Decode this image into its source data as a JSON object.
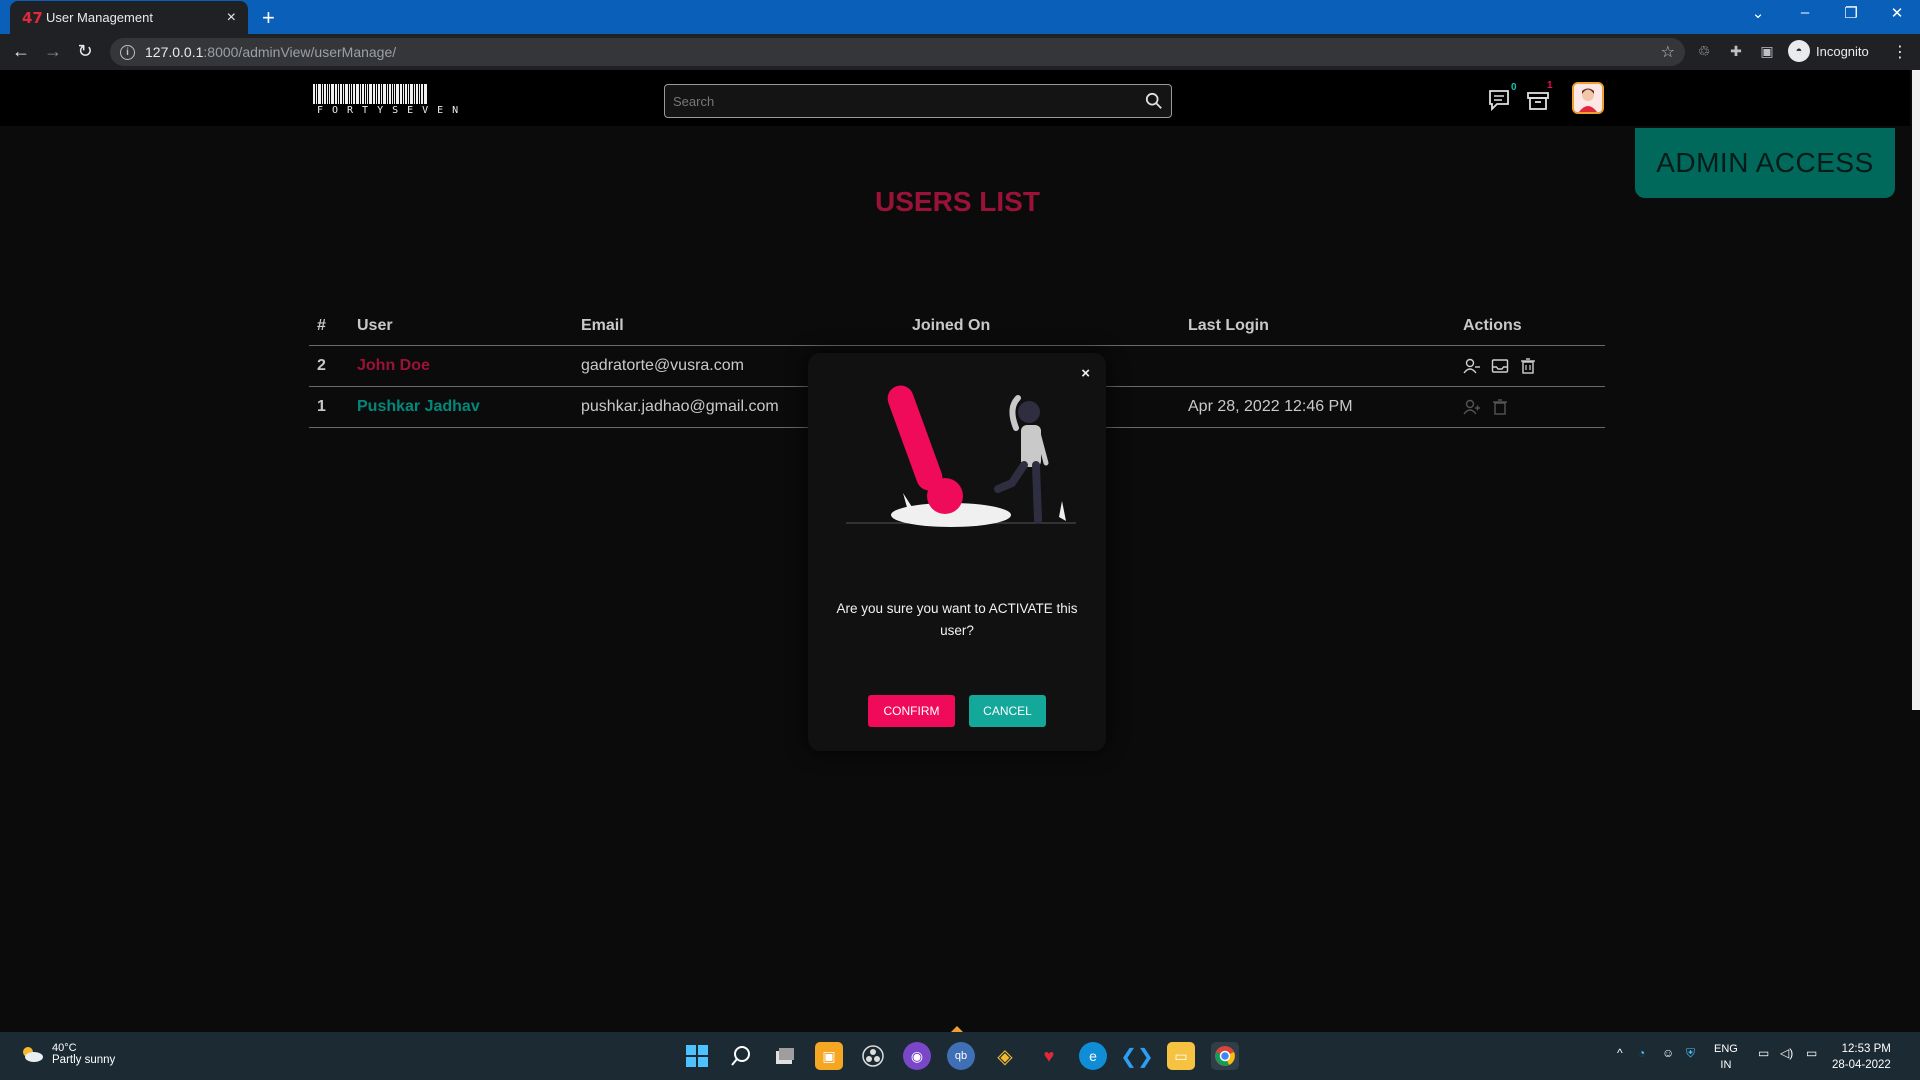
{
  "browser": {
    "tab_icon": "47",
    "tab_title": "User Management",
    "url_host": "127.0.0.1",
    "url_path": ":8000/adminView/userManage/",
    "profile_label": "Incognito"
  },
  "header": {
    "logo_text": "FORTYSEVEN",
    "search_placeholder": "Search",
    "messages_badge": "0",
    "archive_badge": "1",
    "admin_access_label": "ADMIN ACCESS"
  },
  "main": {
    "title": "USERS LIST",
    "columns": [
      "#",
      "User",
      "Email",
      "Joined On",
      "Last Login",
      "Actions"
    ],
    "rows": [
      {
        "num": "2",
        "user": "John Doe",
        "email": "gadratorte@vusra.com",
        "joined": "",
        "last_login": ""
      },
      {
        "num": "1",
        "user": "Pushkar Jadhav",
        "email": "pushkar.jadhao@gmail.com",
        "joined": "",
        "last_login": "Apr 28, 2022 12:46 PM"
      }
    ]
  },
  "modal": {
    "close_label": "×",
    "message": "Are you sure you want to ACTIVATE this user?",
    "confirm_label": "CONFIRM",
    "cancel_label": "CANCEL"
  },
  "taskbar": {
    "weather_temp": "40°C",
    "weather_condition": "Partly sunny",
    "lang_line1": "ENG",
    "lang_line2": "IN",
    "time": "12:53 PM",
    "date": "28-04-2022"
  },
  "colors": {
    "accent_red": "#9b1238",
    "confirm_pink": "#ef0a5a",
    "cancel_teal": "#13a89a",
    "admin_green": "#00695c",
    "browser_blue": "#0a5fb8"
  }
}
